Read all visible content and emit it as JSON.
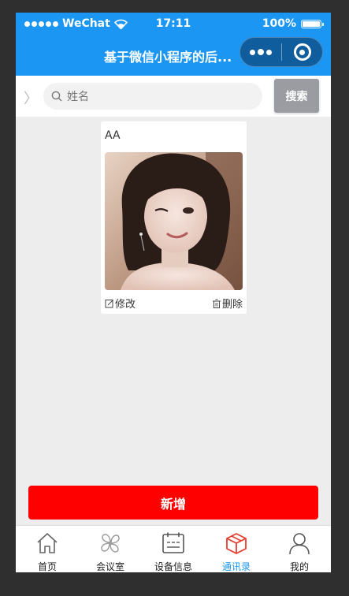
{
  "status_bar": {
    "carrier": "WeChat",
    "time": "17:11",
    "battery": "100%"
  },
  "nav": {
    "title": "基于微信小程序的后..."
  },
  "search": {
    "placeholder": "姓名",
    "button_label": "搜索"
  },
  "contacts": [
    {
      "name": "AA",
      "edit_label": "修改",
      "delete_label": "删除"
    }
  ],
  "add_button_label": "新增",
  "tabbar": {
    "items": [
      {
        "label": "首页",
        "icon": "home-icon"
      },
      {
        "label": "会议室",
        "icon": "clover-icon"
      },
      {
        "label": "设备信息",
        "icon": "calendar-icon"
      },
      {
        "label": "通讯录",
        "icon": "box-icon",
        "active": true
      },
      {
        "label": "我的",
        "icon": "user-icon"
      }
    ]
  },
  "colors": {
    "primary": "#1b96f3",
    "add_button": "#ff0000",
    "search_button": "#9a9ca1",
    "active_tab_icon": "#e43d2f"
  }
}
